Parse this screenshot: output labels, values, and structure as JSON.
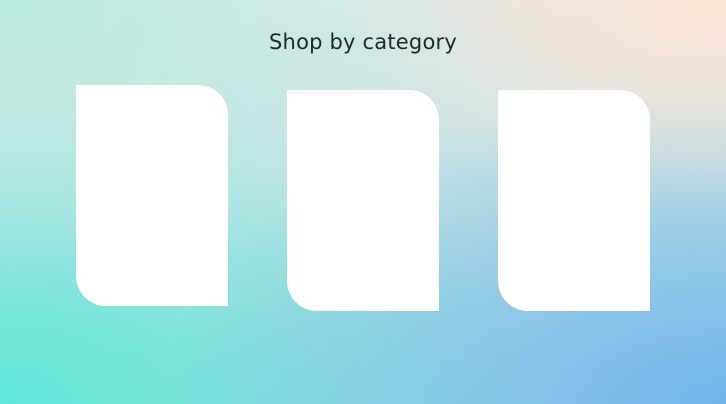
{
  "section": {
    "title": "Shop by category"
  },
  "categories": [
    {
      "label": ""
    },
    {
      "label": ""
    },
    {
      "label": ""
    }
  ]
}
